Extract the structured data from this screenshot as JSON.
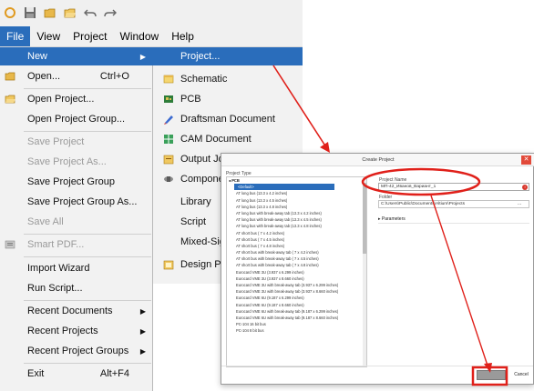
{
  "colors": {
    "accent": "#2a6dbb",
    "annotation": "#e0201a"
  },
  "toolbar": {
    "icons": [
      "new-icon",
      "save-icon",
      "open-icon",
      "open-folder-icon",
      "undo-icon",
      "redo-icon"
    ]
  },
  "menubar": {
    "items": [
      {
        "label": "File",
        "active": true
      },
      {
        "label": "View"
      },
      {
        "label": "Project"
      },
      {
        "label": "Window"
      },
      {
        "label": "Help"
      }
    ]
  },
  "file_menu": {
    "items": [
      {
        "label": "New",
        "shortcut": "",
        "submenu": true,
        "selected": true
      },
      {
        "label": "Open...",
        "shortcut": "Ctrl+O"
      },
      {
        "label": "Open Project..."
      },
      {
        "label": "Open Project Group..."
      },
      {
        "label": "Save Project",
        "disabled": true
      },
      {
        "label": "Save Project As...",
        "disabled": true
      },
      {
        "label": "Save Project Group"
      },
      {
        "label": "Save Project Group As..."
      },
      {
        "label": "Save All",
        "disabled": true
      },
      {
        "label": "Smart PDF...",
        "disabled": true
      },
      {
        "label": "Import Wizard"
      },
      {
        "label": "Run Script..."
      },
      {
        "label": "Recent Documents",
        "submenu": true
      },
      {
        "label": "Recent Projects",
        "submenu": true
      },
      {
        "label": "Recent Project Groups",
        "submenu": true
      },
      {
        "label": "Exit",
        "shortcut": "Alt+F4"
      }
    ]
  },
  "new_submenu": {
    "items": [
      {
        "label": "Project...",
        "selected": true
      },
      {
        "label": "Schematic"
      },
      {
        "label": "PCB"
      },
      {
        "label": "Draftsman Document"
      },
      {
        "label": "CAM Document"
      },
      {
        "label": "Output Jo"
      },
      {
        "label": "Compone"
      },
      {
        "label": "Library"
      },
      {
        "label": "Script"
      },
      {
        "label": "Mixed-Sig"
      },
      {
        "label": "Design Pr"
      }
    ]
  },
  "dialog": {
    "title": "Create Project",
    "project_type_label": "Project Type",
    "project_types": [
      {
        "label": "PCB",
        "header": true
      },
      {
        "label": "<Default>",
        "selected": true
      },
      {
        "label": "AT long bus (13.3 x 4.2 inches)"
      },
      {
        "label": "AT long bus (13.3 x 4.5 inches)"
      },
      {
        "label": "AT long bus (13.3 x 4.8 inches)"
      },
      {
        "label": "AT long bus with break-away tab (13.3 x 4.2 inches)"
      },
      {
        "label": "AT long bus with break-away tab (13.3 x 4.5 inches)"
      },
      {
        "label": "AT long bus with break-away tab (13.3 x 4.8 inches)"
      },
      {
        "label": "AT short bus ( 7 x 4.2 inches)"
      },
      {
        "label": "AT short bus ( 7 x 4.5 inches)"
      },
      {
        "label": "AT short bus ( 7 x 4.8 inches)"
      },
      {
        "label": "AT short bus with break-away tab ( 7 x 4.2 inches)"
      },
      {
        "label": "AT short bus with break-away tab ( 7 x 4.5 inches)"
      },
      {
        "label": "AT short bus with break-away tab ( 7 x 4.8 inches)"
      },
      {
        "label": "Eurocard VME 3U (3.937 x 6.299 inches)"
      },
      {
        "label": "Eurocard VME 3U (3.937 x 8.660 inches)"
      },
      {
        "label": "Eurocard VME 3U with break-away tab (3.937 x 6.299 inches)"
      },
      {
        "label": "Eurocard VME 3U with break-away tab (3.937 x 8.660 inches)"
      },
      {
        "label": "Eurocard VME 6U (9.187 x 6.299 inches)"
      },
      {
        "label": "Eurocard VME 6U (9.187 x 8.660 inches)"
      },
      {
        "label": "Eurocard VME 6U with break-away tab (9.187 x 6.299 inches)"
      },
      {
        "label": "Eurocard VME 6U with break-away tab (9.187 x 8.660 inches)"
      },
      {
        "label": "PC-104 16 bit bus"
      },
      {
        "label": "PC-104 8 bit bus"
      }
    ],
    "project_name_label": "Project Name",
    "project_name_value": "МП-42_Иванов_Вариант_1",
    "location_label": "Folder",
    "location_value": "C:\\Users\\Public\\Documents\\Altium\\Projects",
    "location_button": "...",
    "parameters_label": "Parameters",
    "cancel_label": "Cancel"
  }
}
